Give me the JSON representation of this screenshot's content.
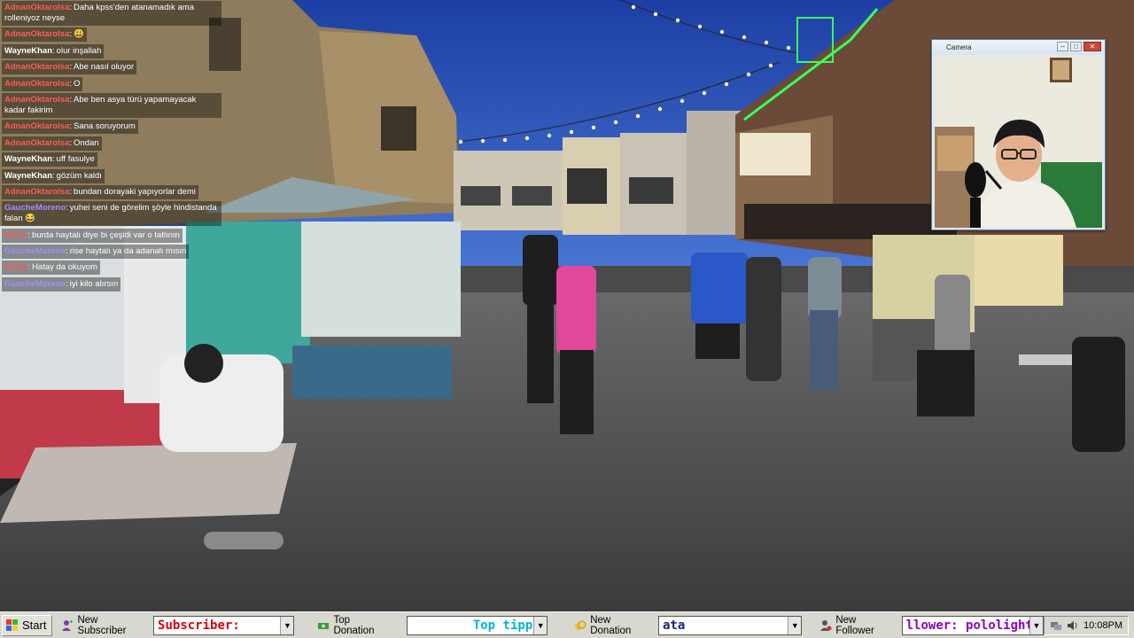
{
  "chat": {
    "messages": [
      {
        "user": "AdnanOktarolsa",
        "text": "Daha kpss'den atanamadık ama rolleniyoz neyse",
        "color": "#ff5a5a"
      },
      {
        "user": "AdnanOktarolsa",
        "text": "😃",
        "color": "#ff5a5a"
      },
      {
        "user": "WayneKhan",
        "text": "olur inşallah",
        "color": "#ffffff"
      },
      {
        "user": "AdnanOktarolsa",
        "text": "Abe nasıl oluyor",
        "color": "#ff5a5a"
      },
      {
        "user": "AdnanOktarolsa",
        "text": "O",
        "color": "#ff5a5a"
      },
      {
        "user": "AdnanOktarolsa",
        "text": "Abe ben asya türü yapamayacak kadar fakirim",
        "color": "#ff5a5a"
      },
      {
        "user": "AdnanOktarolsa",
        "text": "Sana soruyorum",
        "color": "#ff5a5a"
      },
      {
        "user": "AdnanOktarolsa",
        "text": "Ondan",
        "color": "#ff5a5a"
      },
      {
        "user": "WayneKhan",
        "text": "uff fasulye",
        "color": "#ffffff"
      },
      {
        "user": "WayneKhan",
        "text": "gözüm kaldı",
        "color": "#ffffff"
      },
      {
        "user": "AdnanOktarolsa",
        "text": "bundan dorayaki yapıyorlar demi",
        "color": "#ff5a5a"
      },
      {
        "user": "GaucheMoreno",
        "text": "yuhei seni de görelim şöyle hindistanda falan 😂",
        "color": "#a48cff"
      },
      {
        "user": "Hacer",
        "text": "burda haytalı diye bi çeşidi var o tatlının",
        "color": "#ff5a5a"
      },
      {
        "user": "GaucheMoreno",
        "text": "rise haytalı ya da adanalı mısın",
        "color": "#a48cff"
      },
      {
        "user": "Hacer",
        "text": "Hatay da okuyom",
        "color": "#ff5a5a"
      },
      {
        "user": "GaucheMoreno",
        "text": "iyi kilo alırsın",
        "color": "#a48cff"
      }
    ]
  },
  "camera": {
    "title": "Camera",
    "min": "–",
    "max": "□",
    "close": "✕"
  },
  "taskbar": {
    "start": "Start",
    "new_subscriber_label": "New Subscriber",
    "subscriber_value": "Subscriber:",
    "top_donation_label": "Top Donation",
    "top_tipper_value": "Top tippe",
    "new_donation_label": "New Donation",
    "donation_value": "ata",
    "new_follower_label": "New Follower",
    "follower_value": "llower: pololight",
    "clock": "10:08PM",
    "colors": {
      "subscriber": "#d6000e",
      "tipper": "#00b4d8",
      "donation": "#1a237e",
      "follower": "#8a00c8"
    }
  }
}
